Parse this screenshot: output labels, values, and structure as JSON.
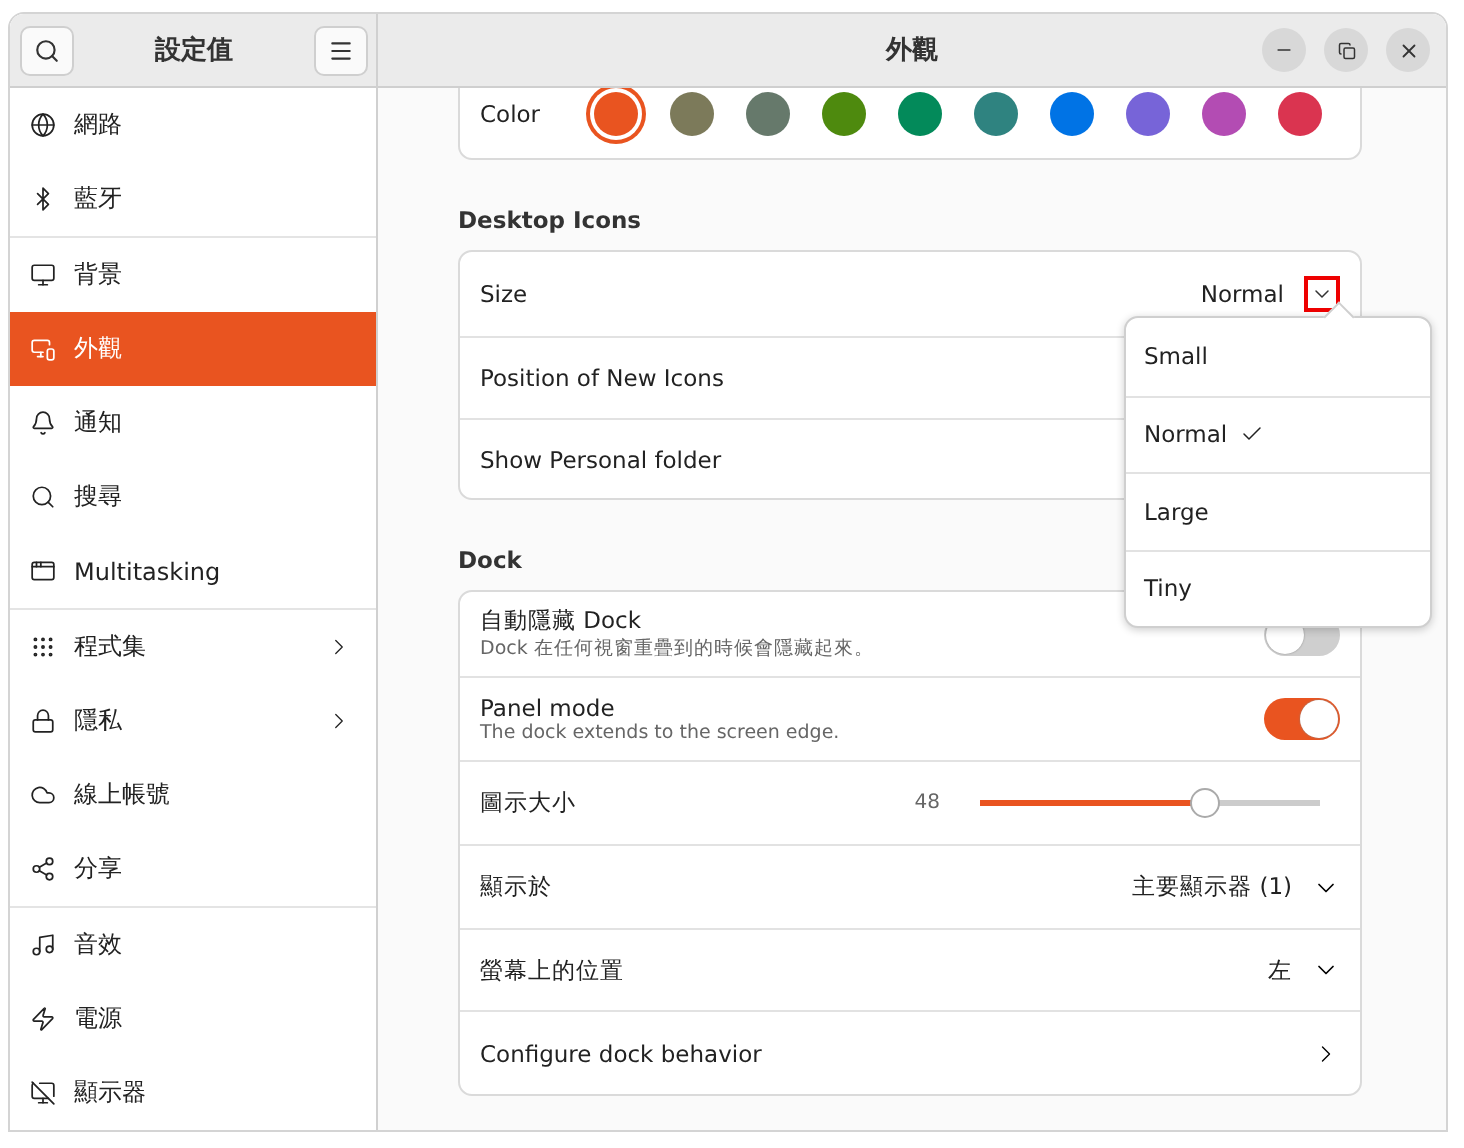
{
  "sidebar": {
    "title": "設定值",
    "groups": [
      [
        {
          "label": "網路",
          "selected": false,
          "submenu": false
        },
        {
          "label": "藍牙",
          "selected": false,
          "submenu": false
        }
      ],
      [
        {
          "label": "背景",
          "selected": false,
          "submenu": false
        },
        {
          "label": "外觀",
          "selected": true,
          "submenu": false
        },
        {
          "label": "通知",
          "selected": false,
          "submenu": false
        },
        {
          "label": "搜尋",
          "selected": false,
          "submenu": false
        },
        {
          "label": "Multitasking",
          "selected": false,
          "submenu": false
        }
      ],
      [
        {
          "label": "程式集",
          "selected": false,
          "submenu": true
        },
        {
          "label": "隱私",
          "selected": false,
          "submenu": true
        },
        {
          "label": "線上帳號",
          "selected": false,
          "submenu": false
        },
        {
          "label": "分享",
          "selected": false,
          "submenu": false
        }
      ],
      [
        {
          "label": "音效",
          "selected": false,
          "submenu": false
        },
        {
          "label": "電源",
          "selected": false,
          "submenu": false
        },
        {
          "label": "顯示器",
          "selected": false,
          "submenu": false
        }
      ]
    ]
  },
  "window": {
    "title": "外觀"
  },
  "color_row": {
    "label": "Color",
    "swatches": [
      {
        "color": "#e95420",
        "selected": true
      },
      {
        "color": "#7c7a5a",
        "selected": false
      },
      {
        "color": "#66796b",
        "selected": false
      },
      {
        "color": "#4e8a0e",
        "selected": false
      },
      {
        "color": "#038a5a",
        "selected": false
      },
      {
        "color": "#2f8380",
        "selected": false
      },
      {
        "color": "#0073e5",
        "selected": false
      },
      {
        "color": "#7764d8",
        "selected": false
      },
      {
        "color": "#b34cb3",
        "selected": false
      },
      {
        "color": "#da3450",
        "selected": false
      }
    ]
  },
  "desktop_icons": {
    "heading": "Desktop Icons",
    "rows": [
      {
        "label": "Size",
        "value": "Normal",
        "kind": "select",
        "highlighted": true
      },
      {
        "label": "Position of New Icons",
        "kind": "plain"
      },
      {
        "label": "Show Personal folder",
        "kind": "plain"
      }
    ]
  },
  "size_menu": [
    {
      "label": "Small",
      "selected": false
    },
    {
      "label": "Normal",
      "selected": true
    },
    {
      "label": "Large",
      "selected": false
    },
    {
      "label": "Tiny",
      "selected": false
    }
  ],
  "dock": {
    "heading": "Dock",
    "rows": [
      {
        "kind": "toggle",
        "label": "自動隱藏 Dock",
        "subtitle": "Dock 在任何視窗重疊到的時候會隱藏起來。",
        "on": false
      },
      {
        "kind": "toggle",
        "label": "Panel mode",
        "subtitle": "The dock extends to the screen edge.",
        "on": true
      },
      {
        "kind": "slider",
        "label": "圖示大小",
        "reading": "48",
        "level": 0.66
      },
      {
        "kind": "select",
        "label": "顯示於",
        "value": "主要顯示器 (1)"
      },
      {
        "kind": "select",
        "label": "螢幕上的位置",
        "value": "左"
      },
      {
        "kind": "link",
        "label": "Configure dock behavior"
      }
    ]
  }
}
